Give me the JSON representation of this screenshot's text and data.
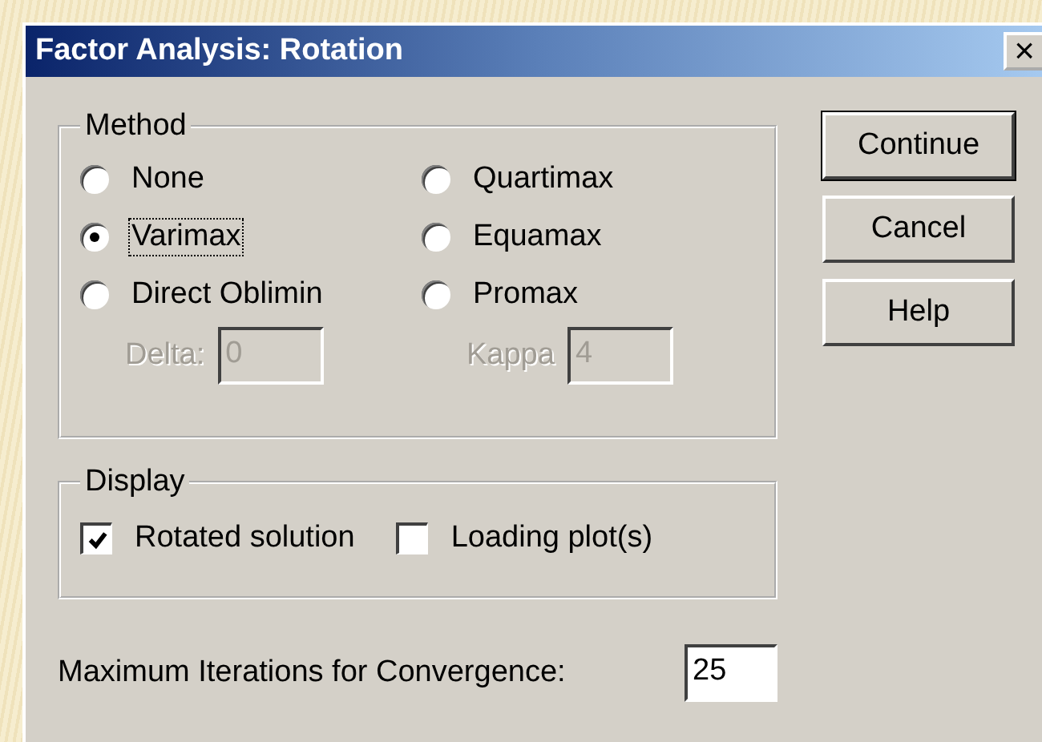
{
  "window": {
    "title": "Factor Analysis: Rotation",
    "close": "×"
  },
  "method": {
    "title": "Method",
    "options": [
      {
        "label": "None",
        "selected": false
      },
      {
        "label": "Quartimax",
        "selected": false
      },
      {
        "label": "Varimax",
        "selected": true,
        "focused": true
      },
      {
        "label": "Equamax",
        "selected": false
      },
      {
        "label": "Direct Oblimin",
        "selected": false
      },
      {
        "label": "Promax",
        "selected": false
      }
    ],
    "params": [
      {
        "label": "Delta:",
        "value": "0",
        "disabled": true
      },
      {
        "label": "Kappa",
        "value": "4",
        "disabled": true
      }
    ]
  },
  "display": {
    "title": "Display",
    "options": [
      {
        "label": "Rotated solution",
        "checked": true
      },
      {
        "label": "Loading plot(s)",
        "checked": false
      }
    ]
  },
  "iterations": {
    "label": "Maximum Iterations for Convergence:",
    "value": "25"
  },
  "buttons": [
    {
      "label": "Continue",
      "default": true
    },
    {
      "label": "Cancel",
      "default": false
    },
    {
      "label": "Help",
      "default": false
    }
  ]
}
